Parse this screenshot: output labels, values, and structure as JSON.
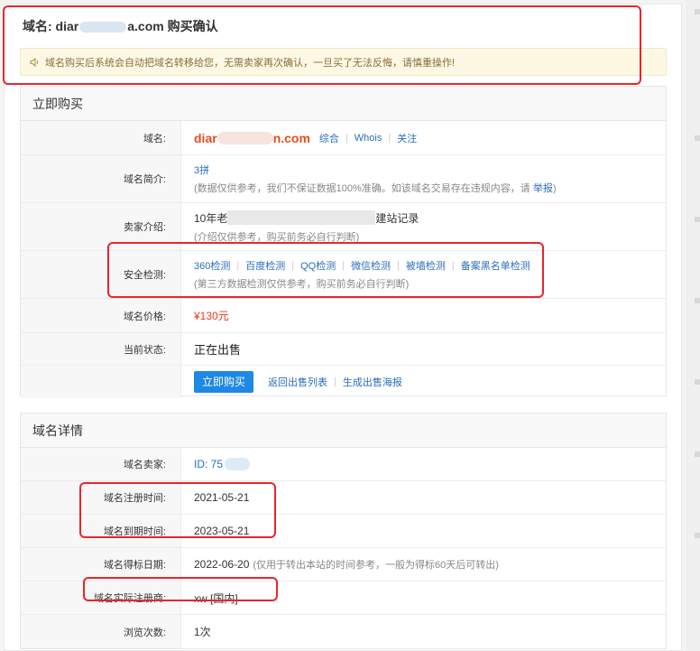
{
  "header": {
    "title_prefix": "域名: diar",
    "title_suffix": "a.com 购买确认"
  },
  "notice": {
    "text": "域名购买后系统会自动把域名转移给您，无需卖家再次确认，一旦买了无法反悔，请慎重操作!"
  },
  "buy_section": {
    "title": "立即购买",
    "rows": {
      "domain": {
        "label": "域名:",
        "value_prefix": "diar",
        "value_suffix": "n.com",
        "links": [
          "综合",
          "Whois",
          "关注"
        ]
      },
      "intro": {
        "label": "域名简介:",
        "value": "3拼",
        "note": "(数据仅供参考，我们不保证数据100%准确。如该域名交易存在违规内容，请",
        "note_link": "举报",
        "note_end": ")"
      },
      "seller": {
        "label": "卖家介绍:",
        "value_prefix": "10年老",
        "value_suffix": "建站记录",
        "note": "(介绍仅供参考，购买前务必自行判断)"
      },
      "security": {
        "label": "安全检测:",
        "links": [
          "360检测",
          "百度检测",
          "QQ检测",
          "微信检测",
          "被墙检测",
          "备案黑名单检测"
        ],
        "note": "(第三方数据检测仅供参考，购买前务必自行判断)"
      },
      "price": {
        "label": "域名价格:",
        "value": "¥130元"
      },
      "status": {
        "label": "当前状态:",
        "value": "正在出售"
      },
      "actions": {
        "buy_button": "立即购买",
        "back_link": "返回出售列表",
        "poster_link": "生成出售海报"
      }
    }
  },
  "detail_section": {
    "title": "域名详情",
    "rows": {
      "seller": {
        "label": "域名卖家:",
        "value": "ID: 75"
      },
      "reg_date": {
        "label": "域名注册时间:",
        "value": "2021-05-21"
      },
      "exp_date": {
        "label": "域名到期时间:",
        "value": "2023-05-21"
      },
      "win_date": {
        "label": "域名得标日期:",
        "value": "2022-06-20",
        "note": "(仅用于转出本站的时间参考，一般为得标60天后可转出)"
      },
      "registrar": {
        "label": "域名实际注册商:",
        "value": "xw [国内]"
      },
      "views": {
        "label": "浏览次数:",
        "value": "1次"
      }
    }
  },
  "colors": {
    "highlight": "#e8262a",
    "domain": "#e84b1e",
    "link": "#2a6ebb",
    "button": "#1e88e5",
    "notice_bg": "#fcf8e3"
  },
  "icons": {
    "notice": "speaker-icon"
  }
}
